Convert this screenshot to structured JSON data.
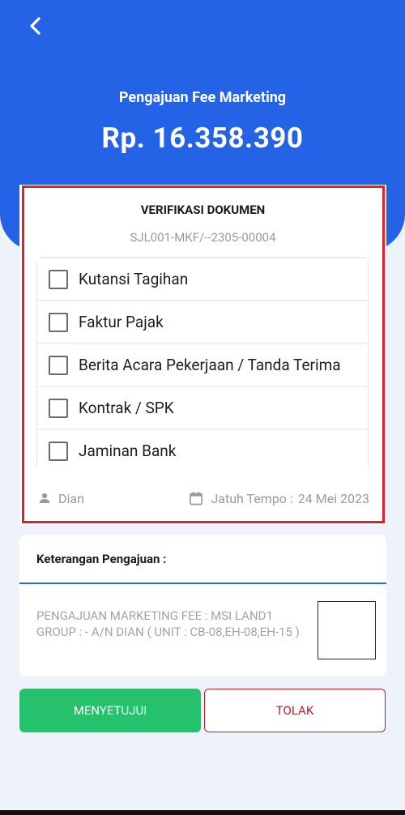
{
  "header": {
    "title": "Pengajuan Fee Marketing",
    "amount": "Rp. 16.358.390",
    "back_icon": "chevron-left-icon",
    "background_color": "#2563e6"
  },
  "verification": {
    "title": "VERIFIKASI DOKUMEN",
    "document_number": "SJL001-MKF/--2305-00004",
    "documents": [
      {
        "label": "Kutansi Tagihan",
        "checked": false
      },
      {
        "label": "Faktur Pajak",
        "checked": false
      },
      {
        "label": "Berita Acara Pekerjaan / Tanda Terima",
        "checked": false
      },
      {
        "label": "Kontrak / SPK",
        "checked": false
      },
      {
        "label": "Jaminan Bank",
        "checked": false
      }
    ],
    "user_name": "Dian",
    "due_label": "Jatuh Tempo :",
    "due_date": "24 Mei 2023",
    "highlight_color": "#e0202e"
  },
  "notes": {
    "heading": "Keterangan Pengajuan :",
    "text": "PENGAJUAN MARKETING FEE : MSI LAND1 GROUP : - A/N DIAN ( UNIT : CB-08,EH-08,EH-15 )"
  },
  "actions": {
    "approve_label": "MENYETUJUI",
    "reject_label": "TOLAK",
    "approve_color": "#25c16d",
    "reject_color": "#b22028"
  }
}
